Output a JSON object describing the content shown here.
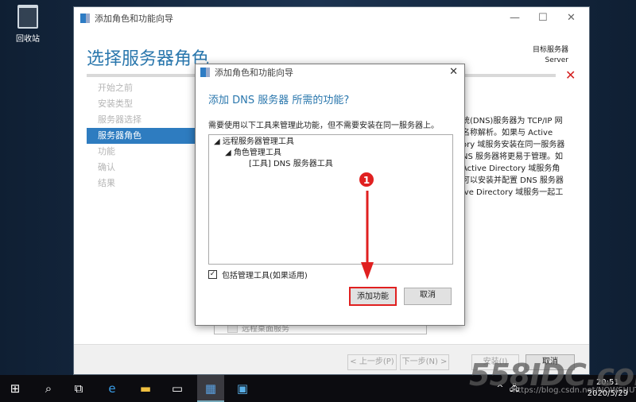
{
  "desktop": {
    "recycle_bin": "回收站"
  },
  "wizard": {
    "title": "添加角色和功能向导",
    "heading": "选择服务器角色",
    "target_label": "目标服务器",
    "target_value": "Server",
    "nav": [
      "开始之前",
      "安装类型",
      "服务器选择",
      "服务器角色",
      "功能",
      "确认",
      "结果"
    ],
    "selected_nav": 3,
    "description": [
      "统(DNS)服务器为 TCP/IP 网",
      "名称解析。如果与 Active",
      "ory 域服务安装在同一服务器",
      "NS 服务器将更易于管理。如",
      " Active Directory 域服务角",
      "可以安装并配置 DNS 服务器",
      "ive Directory 域服务一起工"
    ],
    "list_item": "远程桌面服务",
    "buttons": {
      "prev": "< 上一步(P)",
      "next": "下一步(N) >",
      "install": "安装(I)",
      "cancel": "取消"
    }
  },
  "dialog": {
    "title": "添加角色和功能向导",
    "heading": "添加 DNS 服务器 所需的功能?",
    "text": "需要使用以下工具来管理此功能，但不需要安装在同一服务器上。",
    "tree": [
      "远程服务器管理工具",
      "角色管理工具",
      "[工具] DNS 服务器工具"
    ],
    "checkbox_label": "包括管理工具(如果适用)",
    "checkbox_checked": true,
    "add_button": "添加功能",
    "cancel_button": "取消"
  },
  "annotation": {
    "step": "1",
    "color": "#e02020"
  },
  "taskbar": {
    "time": "20:51",
    "date": "2020/5/29"
  },
  "watermark": {
    "logo": "558IDC.com",
    "url": "https://blog.csdn.net/NOWSHUT"
  }
}
